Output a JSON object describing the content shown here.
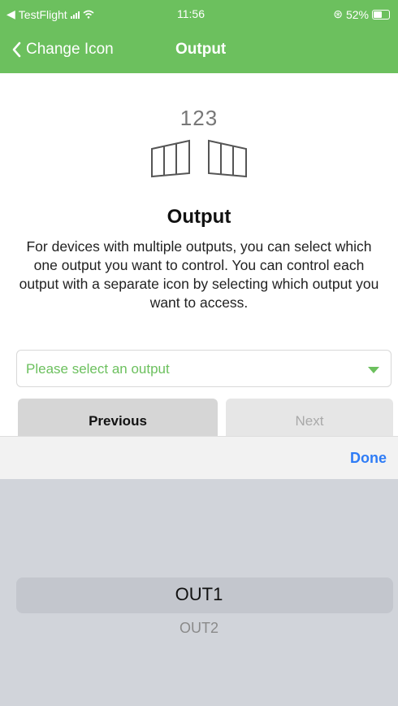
{
  "status_bar": {
    "carrier": "TestFlight",
    "time": "11:56",
    "battery": "52%"
  },
  "nav": {
    "back_label": "Change Icon",
    "title": "Output"
  },
  "hero": {
    "icon_number": "123",
    "icon_name": "panels-icon"
  },
  "content": {
    "title": "Output",
    "description": "For devices with multiple outputs, you can select which one output you want to control. You can control each output with a separate icon by selecting which output you want to access."
  },
  "select": {
    "placeholder": "Please select an output"
  },
  "buttons": {
    "previous": "Previous",
    "next": "Next"
  },
  "picker_toolbar": {
    "done": "Done"
  },
  "picker": {
    "options": [
      "OUT1",
      "OUT2"
    ],
    "selected": "OUT1"
  },
  "colors": {
    "accent": "#6cc05e",
    "link": "#2e7cf6"
  }
}
